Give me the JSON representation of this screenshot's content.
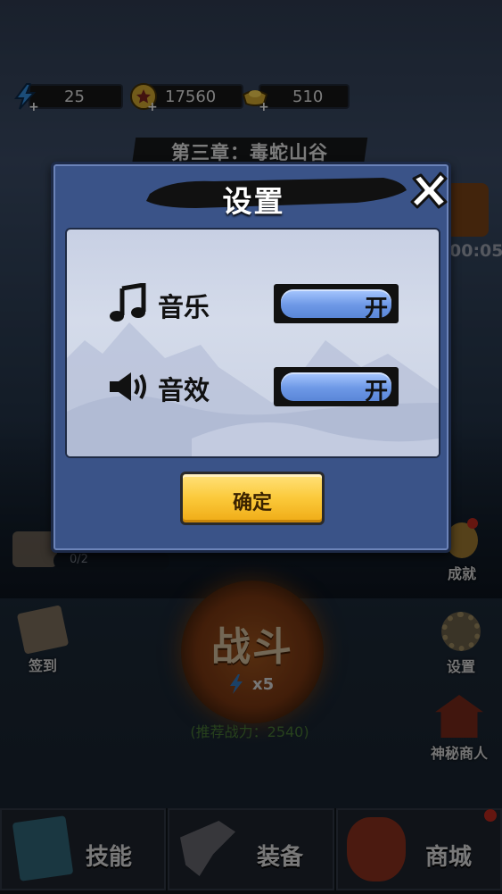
{
  "resources": {
    "energy": "25",
    "coins": "17560",
    "gold": "510"
  },
  "chapter": {
    "title": "第三章：毒蛇山谷"
  },
  "timer_fragment": "00:05",
  "progress_text": "0/2",
  "side_menu": {
    "achievement": "成就",
    "checkin": "签到",
    "settings": "设置",
    "merchant": "神秘商人"
  },
  "battle": {
    "label": "战斗",
    "cost": "x5",
    "recommended": "(推荐战力：2540)"
  },
  "tabs": [
    {
      "label": "技能"
    },
    {
      "label": "装备"
    },
    {
      "label": "商城"
    }
  ],
  "dialog": {
    "title": "设置",
    "music_label": "音乐",
    "music_state": "开",
    "sfx_label": "音效",
    "sfx_state": "开",
    "confirm_label": "确定"
  },
  "colors": {
    "dialog_bg": "#3a5388",
    "panel_bg": "#cfd6e8",
    "toggle_blue": "#6d98e6",
    "confirm_yellow": "#fbc93a"
  }
}
